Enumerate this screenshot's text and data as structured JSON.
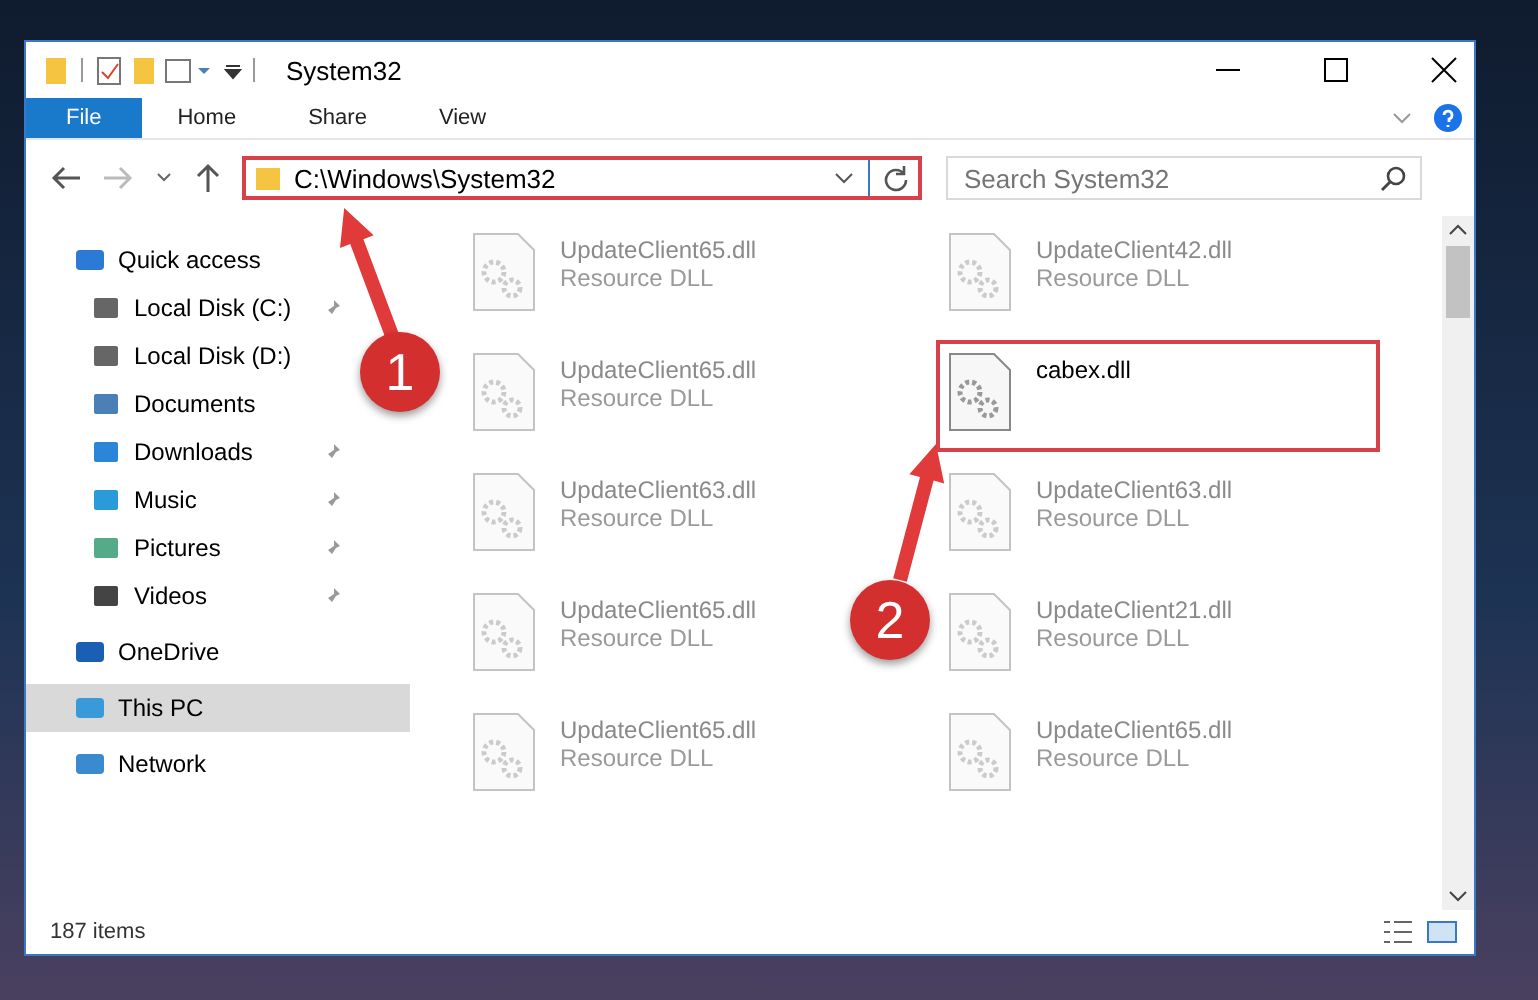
{
  "window": {
    "title": "System32"
  },
  "ribbon_tabs": [
    {
      "label": "File",
      "selected": true
    },
    {
      "label": "Home",
      "selected": false
    },
    {
      "label": "Share",
      "selected": false
    },
    {
      "label": "View",
      "selected": false
    }
  ],
  "address": {
    "path": "C:\\Windows\\System32"
  },
  "search": {
    "placeholder": "Search System32"
  },
  "sidebar": {
    "items": [
      {
        "label": "Quick access",
        "selected": false,
        "children": [
          {
            "label": "Local Disk (C:)",
            "pinned": true,
            "selected": false
          },
          {
            "label": "Local Disk (D:)",
            "pinned": false,
            "selected": false
          },
          {
            "label": "Documents",
            "pinned": false,
            "selected": false
          },
          {
            "label": "Downloads",
            "pinned": true,
            "selected": false
          },
          {
            "label": "Music",
            "pinned": true,
            "selected": false
          },
          {
            "label": "Pictures",
            "pinned": true,
            "selected": false
          },
          {
            "label": "Videos",
            "pinned": true,
            "selected": false
          }
        ]
      },
      {
        "label": "OneDrive",
        "selected": false
      },
      {
        "label": "This PC",
        "selected": true
      },
      {
        "label": "Network",
        "selected": false
      }
    ]
  },
  "files": [
    {
      "name": "UpdateClient65.dll",
      "type": "Resource DLL",
      "faded": true,
      "selected": false
    },
    {
      "name": "UpdateClient42.dll",
      "type": "Resource DLL",
      "faded": true,
      "selected": false
    },
    {
      "name": "UpdateClient65.dll",
      "type": "Resource DLL",
      "faded": true,
      "selected": false
    },
    {
      "name": "cabex.dll",
      "faded": false,
      "selected": true
    },
    {
      "name": "UpdateClient63.dll",
      "type": "Resource DLL",
      "faded": true,
      "selected": false
    },
    {
      "name": "UpdateClient63.dll",
      "type": "Resource DLL",
      "faded": true,
      "selected": false
    },
    {
      "name": "UpdateClient65.dll",
      "type": "Resource DLL",
      "faded": true,
      "selected": false
    },
    {
      "name": "UpdateClient21.dll",
      "type": "Resource DLL",
      "faded": true,
      "selected": false
    },
    {
      "name": "UpdateClient65.dll",
      "type": "Resource DLL",
      "faded": true,
      "selected": false
    },
    {
      "name": "UpdateClient65.dll",
      "type": "Resource DLL",
      "faded": true,
      "selected": false
    }
  ],
  "step_badges": [
    "1",
    "2"
  ],
  "status_bar": {
    "count": "187 items"
  }
}
